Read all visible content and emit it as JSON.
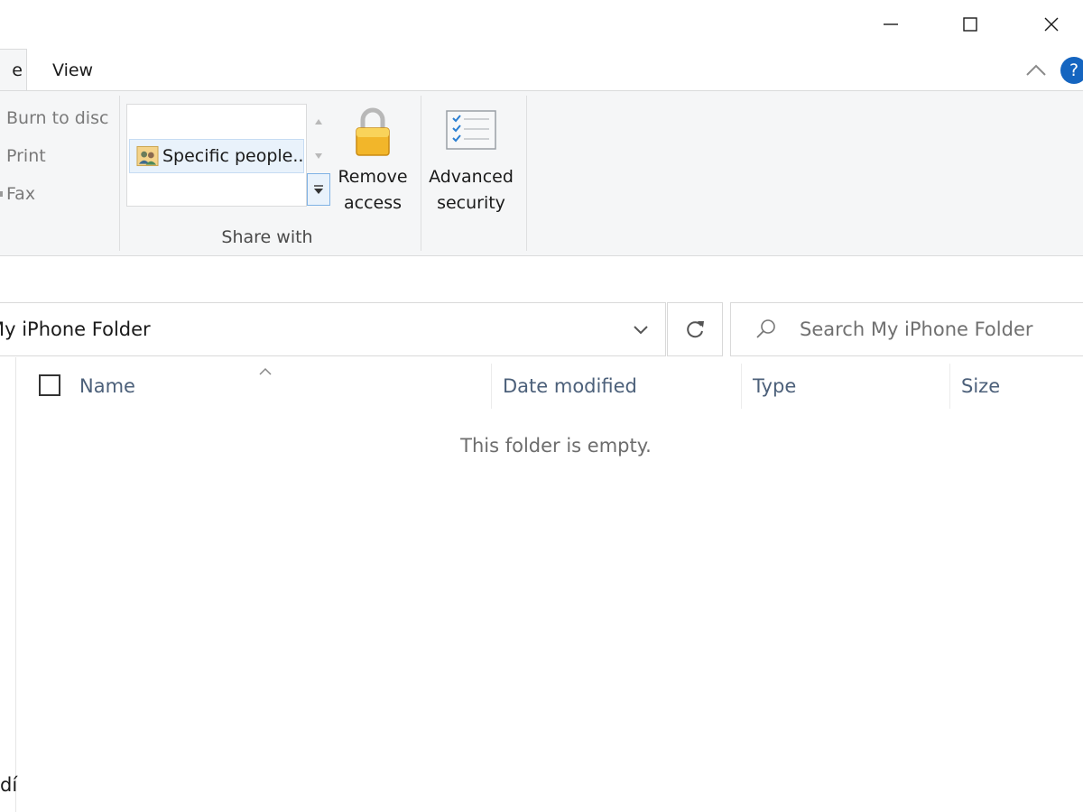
{
  "window": {
    "minimize_icon": "minimize-icon",
    "maximize_icon": "maximize-icon",
    "close_icon": "close-icon"
  },
  "tabs": {
    "active_partial": "e",
    "view": "View",
    "collapse_icon": "chevron-up-icon",
    "help": "?"
  },
  "ribbon": {
    "send_group": {
      "burn_to_disc": "Burn to disc",
      "print": "Print",
      "fax": "Fax"
    },
    "share_with": {
      "gallery_item": "Specific people...",
      "group_label": "Share with"
    },
    "remove_access": {
      "line1": "Remove",
      "line2": "access"
    },
    "advanced_security": {
      "line1": "Advanced",
      "line2": "security"
    }
  },
  "address": {
    "path": "My iPhone Folder",
    "search_placeholder": "Search My iPhone Folder"
  },
  "columns": {
    "name": "Name",
    "date_modified": "Date modified",
    "type": "Type",
    "size": "Size"
  },
  "content": {
    "empty_message": "This folder is empty.",
    "nav_partial": "dí"
  },
  "colors": {
    "ribbon_bg": "#f5f6f7",
    "header_text": "#4c607a",
    "help_blue": "#1565c0",
    "selection": "#e9f2fb"
  }
}
